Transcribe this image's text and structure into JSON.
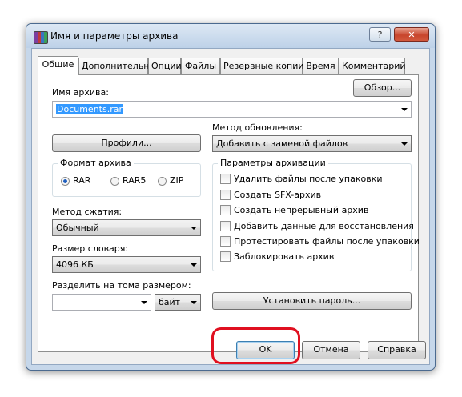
{
  "window": {
    "title": "Имя и параметры архива",
    "help_button": "?",
    "close_button": "✕"
  },
  "tabs": [
    {
      "label": "Общие",
      "active": true
    },
    {
      "label": "Дополнительно",
      "active": false
    },
    {
      "label": "Опции",
      "active": false
    },
    {
      "label": "Файлы",
      "active": false
    },
    {
      "label": "Резервные копии",
      "active": false
    },
    {
      "label": "Время",
      "active": false
    },
    {
      "label": "Комментарий",
      "active": false
    }
  ],
  "general": {
    "archive_name_label": "Имя архива:",
    "browse_button": "Обзор...",
    "archive_name_value": "Documents.rar",
    "update_method_label": "Метод обновления:",
    "update_method_value": "Добавить с заменой файлов",
    "profiles_button": "Профили...",
    "format_group_title": "Формат архива",
    "formats": [
      {
        "label": "RAR",
        "selected": true
      },
      {
        "label": "RAR5",
        "selected": false
      },
      {
        "label": "ZIP",
        "selected": false
      }
    ],
    "compression_label": "Метод сжатия:",
    "compression_value": "Обычный",
    "dictionary_label": "Размер словаря:",
    "dictionary_value": "4096 КБ",
    "split_label": "Разделить на тома размером:",
    "split_value": "",
    "split_unit": "байт",
    "archive_options_title": "Параметры архивации",
    "options": [
      {
        "label": "Удалить файлы после упаковки",
        "checked": false
      },
      {
        "label": "Создать SFX-архив",
        "checked": false
      },
      {
        "label": "Создать непрерывный архив",
        "checked": false
      },
      {
        "label": "Добавить данные для восстановления",
        "checked": false
      },
      {
        "label": "Протестировать файлы после упаковки",
        "checked": false
      },
      {
        "label": "Заблокировать архив",
        "checked": false
      }
    ],
    "set_password_button": "Установить пароль..."
  },
  "footer": {
    "ok_button": "OK",
    "cancel_button": "Отмена",
    "help_button": "Справка"
  },
  "colors": {
    "highlight": "#e01020",
    "selection": "#3399ff",
    "title_bar": "#c6d7ea"
  }
}
